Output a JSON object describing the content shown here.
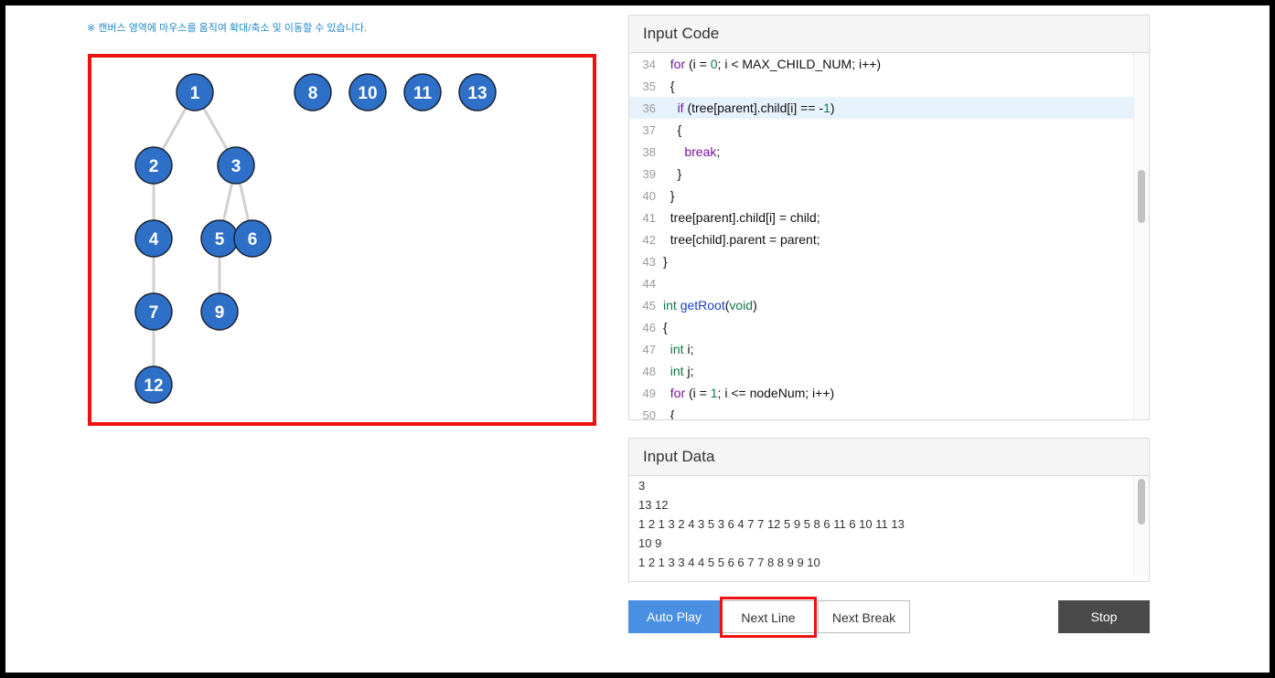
{
  "hint": "※ 캔버스 영역에 마우스를 움직여 확대/축소 및 이동할 수 있습니다.",
  "tree": {
    "nodes": [
      {
        "id": "1",
        "label": "1"
      },
      {
        "id": "2",
        "label": "2"
      },
      {
        "id": "3",
        "label": "3"
      },
      {
        "id": "4",
        "label": "4"
      },
      {
        "id": "5",
        "label": "5"
      },
      {
        "id": "6",
        "label": "6"
      },
      {
        "id": "7",
        "label": "7"
      },
      {
        "id": "8",
        "label": "8"
      },
      {
        "id": "9",
        "label": "9"
      },
      {
        "id": "10",
        "label": "10"
      },
      {
        "id": "11",
        "label": "11"
      },
      {
        "id": "12",
        "label": "12"
      },
      {
        "id": "13",
        "label": "13"
      }
    ],
    "edges": [
      [
        "1",
        "2"
      ],
      [
        "1",
        "3"
      ],
      [
        "2",
        "4"
      ],
      [
        "3",
        "5"
      ],
      [
        "3",
        "6"
      ],
      [
        "4",
        "7"
      ],
      [
        "5",
        "9"
      ],
      [
        "7",
        "12"
      ]
    ],
    "node_color": "#2e6fc8",
    "edge_color": "#d0d0d0"
  },
  "code_panel": {
    "title": "Input Code",
    "highlighted_line": "36",
    "lines": [
      {
        "n": "34",
        "html": "  <span class=\"kw\">for</span> (i = <span class=\"num\">0</span>; i &lt; MAX_CHILD_NUM; i++)"
      },
      {
        "n": "35",
        "html": "  {"
      },
      {
        "n": "36",
        "html": "    <span class=\"kw\">if</span> (tree[parent].child[i] == -<span class=\"num\">1</span>)"
      },
      {
        "n": "37",
        "html": "    {"
      },
      {
        "n": "38",
        "html": "      <span class=\"kw\">break</span>;"
      },
      {
        "n": "39",
        "html": "    }"
      },
      {
        "n": "40",
        "html": "  }"
      },
      {
        "n": "41",
        "html": "  tree[parent].child[i] = child;"
      },
      {
        "n": "42",
        "html": "  tree[child].parent = parent;"
      },
      {
        "n": "43",
        "html": "}"
      },
      {
        "n": "44",
        "html": ""
      },
      {
        "n": "45",
        "html": "<span class=\"ty\">int</span> <span class=\"fn\">getRoot</span>(<span class=\"ty\">void</span>)"
      },
      {
        "n": "46",
        "html": "{"
      },
      {
        "n": "47",
        "html": "  <span class=\"ty\">int</span> i;"
      },
      {
        "n": "48",
        "html": "  <span class=\"ty\">int</span> j;"
      },
      {
        "n": "49",
        "html": "  <span class=\"kw\">for</span> (i = <span class=\"num\">1</span>; i &lt;= nodeNum; i++)"
      },
      {
        "n": "50",
        "html": "  {"
      }
    ]
  },
  "data_panel": {
    "title": "Input Data",
    "lines": [
      "3",
      "13 12",
      "1 2 1 3 2 4 3 5 3 6 4 7 7 12 5 9 5 8 6 11 6 10 11 13",
      "10 9",
      "1 2 1 3 3 4 4 5 5 6 6 7 7 8 8 9 9 10"
    ]
  },
  "buttons": {
    "auto_play": "Auto Play",
    "next_line": "Next Line",
    "next_break": "Next Break",
    "stop": "Stop"
  }
}
